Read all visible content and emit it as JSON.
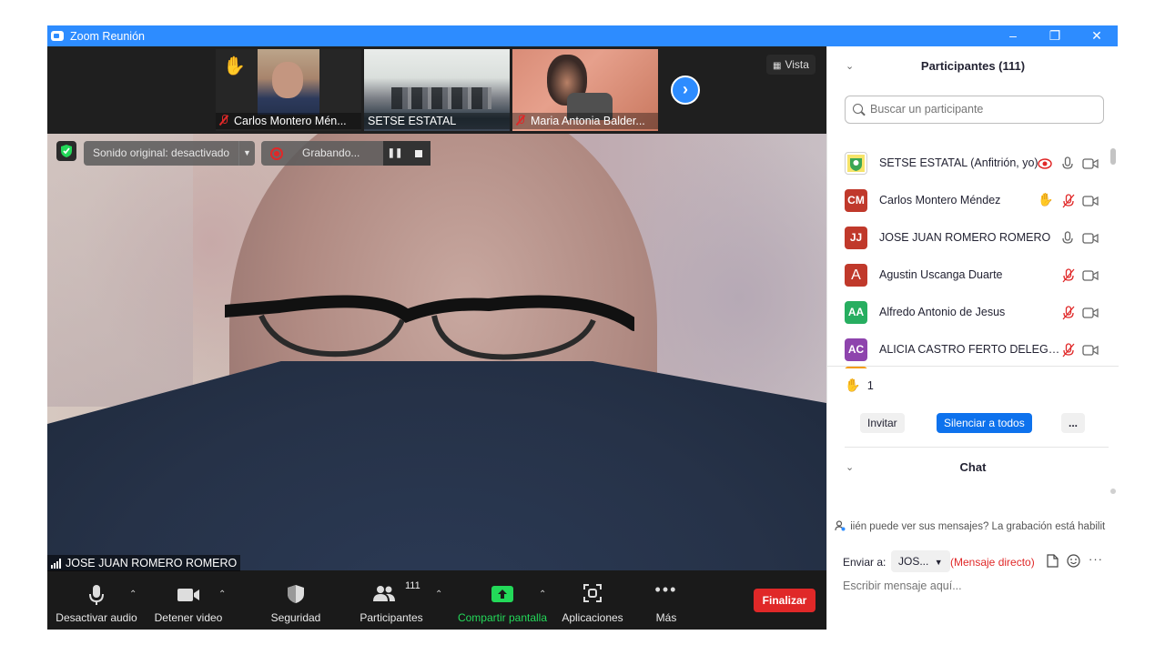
{
  "window": {
    "title": "Zoom Reunión"
  },
  "strip": {
    "thumbs": [
      {
        "name": "Carlos Montero  Mén...",
        "hand": true
      },
      {
        "name": "SETSE ESTATAL"
      },
      {
        "name": "Maria Antonia Balder..."
      }
    ],
    "view_label": "Vista"
  },
  "overlays": {
    "original_sound": "Sonido original: desactivado",
    "recording": "Grabando..."
  },
  "main_speaker": {
    "name": "JOSE JUAN ROMERO ROMERO"
  },
  "toolbar": {
    "mute": "Desactivar audio",
    "video": "Detener video",
    "security": "Seguridad",
    "participants": "Participantes",
    "participants_count": "111",
    "share": "Compartir pantalla",
    "apps": "Aplicaciones",
    "more": "Más",
    "end": "Finalizar"
  },
  "participants_panel": {
    "title": "Participantes (111)",
    "search_placeholder": "Buscar un participante",
    "rows": [
      {
        "initials": "",
        "name": "SETSE ESTATAL (Anfitrión, yo)",
        "color": "#ffffff",
        "mic": "on"
      },
      {
        "initials": "CM",
        "name": "Carlos Montero  Méndez",
        "color": "#c0392b",
        "mic": "muted",
        "hand": true
      },
      {
        "initials": "JJ",
        "name": "JOSE JUAN ROMERO ROMERO",
        "color": "#c0392b",
        "mic": "on"
      },
      {
        "initials": "A",
        "name": "Agustin Uscanga Duarte",
        "color": "#c0392b",
        "mic": "muted"
      },
      {
        "initials": "AA",
        "name": "Alfredo Antonio de Jesus",
        "color": "#27ae60",
        "mic": "muted"
      },
      {
        "initials": "AC",
        "name": "ALICIA CASTRO FERTO DELEGAC...",
        "color": "#8e44ad",
        "mic": "muted"
      }
    ],
    "raised_hands": "1",
    "invite": "Invitar",
    "mute_all": "Silenciar a todos",
    "more": "..."
  },
  "chat": {
    "title": "Chat",
    "notice": "iién puede ver sus mensajes? La grabación está habilit",
    "send_to_label": "Enviar a:",
    "recipient": "JOS...",
    "direct": "(Mensaje directo)",
    "placeholder": "Escribir mensaje aquí..."
  },
  "colors": {
    "zoom_blue": "#2d8cff",
    "end_red": "#e02828",
    "share_green": "#23d959"
  }
}
